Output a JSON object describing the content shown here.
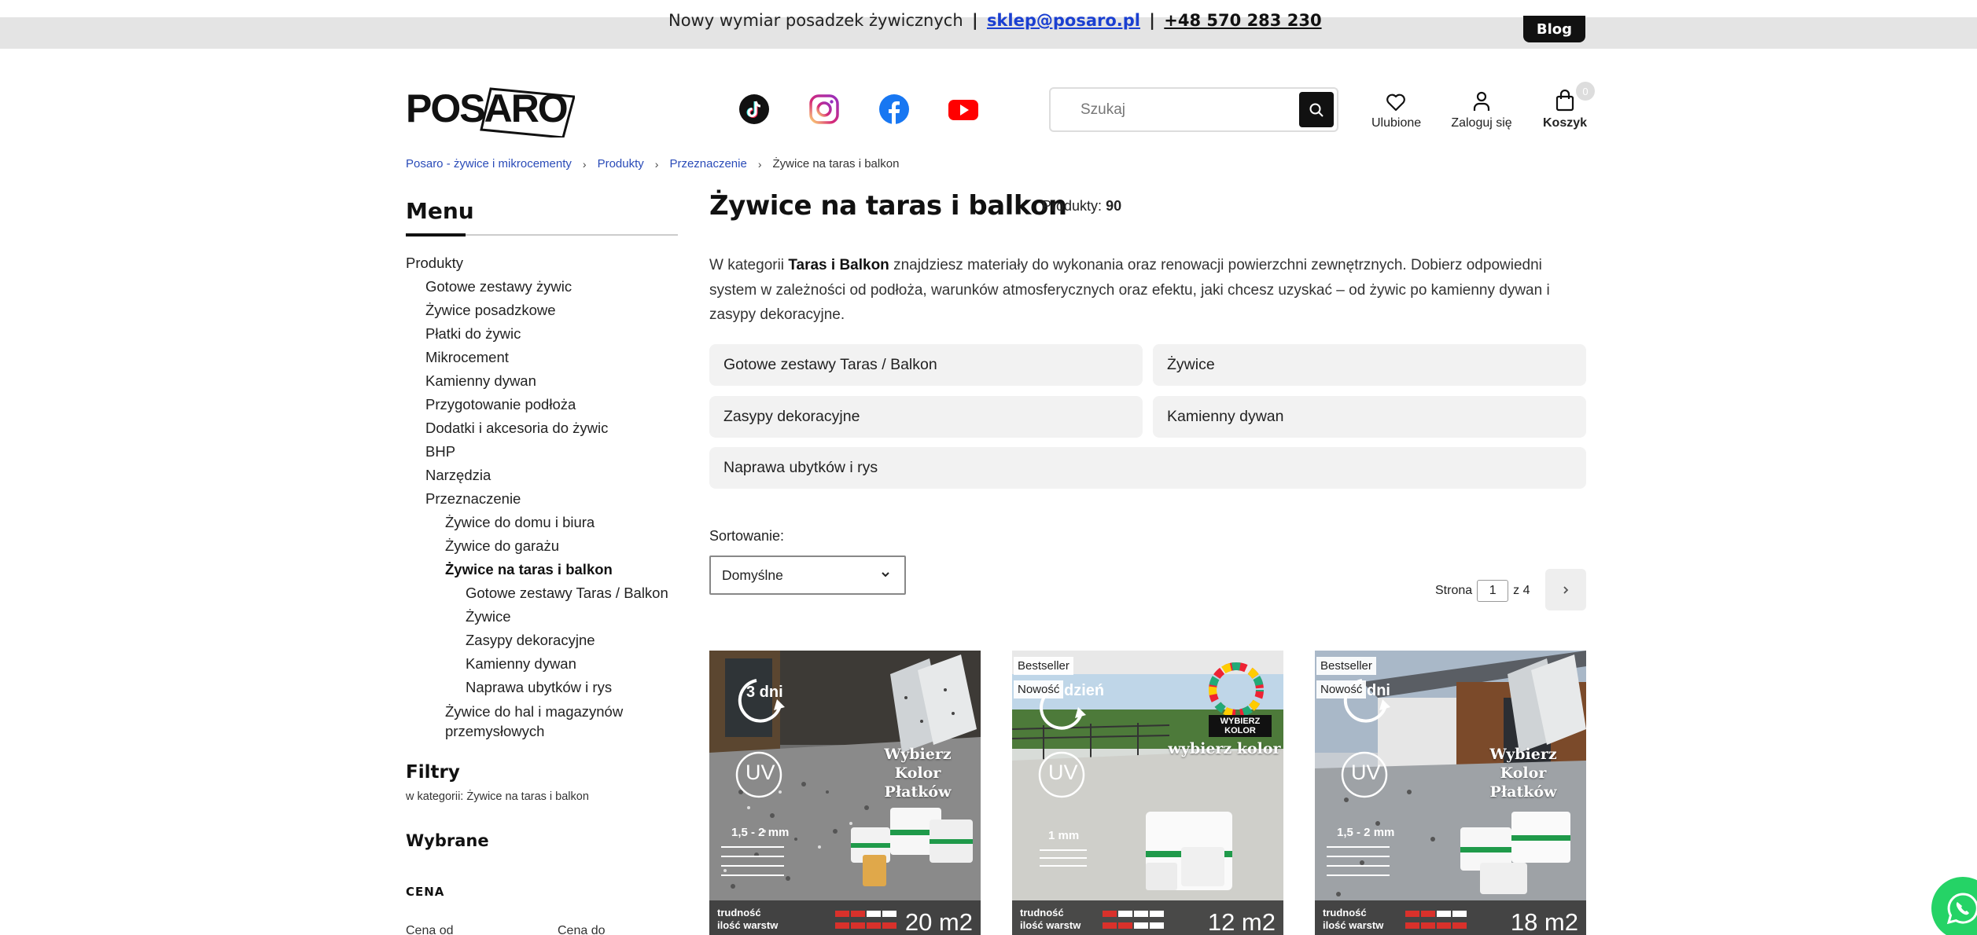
{
  "topbar": {
    "text": "Nowy wymiar posadzek żywicznych",
    "email": "sklep@posaro.pl",
    "phone": "+48 570 283 230",
    "blog_label": "Blog"
  },
  "header": {
    "logo_text": "POSARO",
    "social": [
      "tiktok-icon",
      "instagram-icon",
      "facebook-icon",
      "youtube-icon"
    ],
    "search_placeholder": "Szukaj",
    "favorites_label": "Ulubione",
    "login_label": "Zaloguj się",
    "cart_label": "Koszyk",
    "cart_count": "0"
  },
  "breadcrumb": [
    "Posaro - żywice i mikrocementy",
    "Produkty",
    "Przeznaczenie",
    "Żywice na taras i balkon"
  ],
  "sidebar": {
    "title": "Menu",
    "items": [
      {
        "label": "Produkty",
        "level": 0
      },
      {
        "label": "Gotowe zestawy żywic",
        "level": 1
      },
      {
        "label": "Żywice posadzkowe",
        "level": 1
      },
      {
        "label": "Płatki do żywic",
        "level": 1
      },
      {
        "label": "Mikrocement",
        "level": 1
      },
      {
        "label": "Kamienny dywan",
        "level": 1
      },
      {
        "label": "Przygotowanie podłoża",
        "level": 1
      },
      {
        "label": "Dodatki i akcesoria do żywic",
        "level": 1
      },
      {
        "label": "BHP",
        "level": 1
      },
      {
        "label": "Narzędzia",
        "level": 1
      },
      {
        "label": "Przeznaczenie",
        "level": 1
      },
      {
        "label": "Żywice do domu i biura",
        "level": 2
      },
      {
        "label": "Żywice do garażu",
        "level": 2
      },
      {
        "label": "Żywice na taras i balkon",
        "level": 2,
        "active": true
      },
      {
        "label": "Gotowe zestawy Taras / Balkon",
        "level": 3
      },
      {
        "label": "Żywice",
        "level": 3
      },
      {
        "label": "Zasypy dekoracyjne",
        "level": 3
      },
      {
        "label": "Kamienny dywan",
        "level": 3
      },
      {
        "label": "Naprawa ubytków i rys",
        "level": 3
      },
      {
        "label": "Żywice do hal i magazynów przemysłowych",
        "level": 2,
        "wrap": true
      }
    ],
    "filters_title": "Filtry",
    "filters_sub": "w kategorii: Żywice na taras i balkon",
    "selected_title": "Wybrane",
    "price_title": "CENA",
    "price_from": "Cena od",
    "price_to": "Cena do"
  },
  "main": {
    "title": "Żywice na taras i balkon",
    "count_label": "Produkty:",
    "count_value": "90",
    "intro_pre": "W kategorii ",
    "intro_bold": "Taras i Balkon",
    "intro_post": " znajdziesz materiały do wykonania oraz renowacji powierzchni zewnętrznych. Dobierz odpowiedni system w zależności od podłoża, warunków atmosferycznych oraz efektu, jaki chcesz uzyskać – od żywic po kamienny dywan i zasypy dekoracyjne.",
    "subcategories": [
      "Gotowe zestawy Taras / Balkon",
      "Żywice",
      "Zasypy dekoracyjne",
      "Kamienny dywan",
      "Naprawa ubytków i rys"
    ],
    "sort_label": "Sortowanie:",
    "sort_value": "Domyślne",
    "pager_label": "Strona",
    "pager_value": "1",
    "pager_total": "z 4"
  },
  "products": [
    {
      "badges": [],
      "days": "3 dni",
      "headline": "Wybierz Kolor Płatków",
      "uv": "UV",
      "mm": "1,5 - 2 mm",
      "scale1": "trudność",
      "scale2": "ilość warstw",
      "area": "20 m2"
    },
    {
      "badges": [
        "Bestseller",
        "Nowość"
      ],
      "days": "dzień",
      "headline": "wybierz kolor",
      "stamp": "WYBIERZ KOLOR",
      "uv": "UV",
      "mm": "1 mm",
      "scale1": "trudność",
      "scale2": "ilość warstw",
      "area": "12 m2"
    },
    {
      "badges": [
        "Bestseller",
        "Nowość"
      ],
      "days": "dni",
      "headline": "Wybierz Kolor Płatków",
      "uv": "UV",
      "mm": "1,5 - 2 mm",
      "scale1": "trudność",
      "scale2": "ilość warstw",
      "area": "18 m2"
    }
  ],
  "colors": {
    "accent": "#111111",
    "link": "#2a4bb8",
    "whatsapp": "#25d366"
  }
}
